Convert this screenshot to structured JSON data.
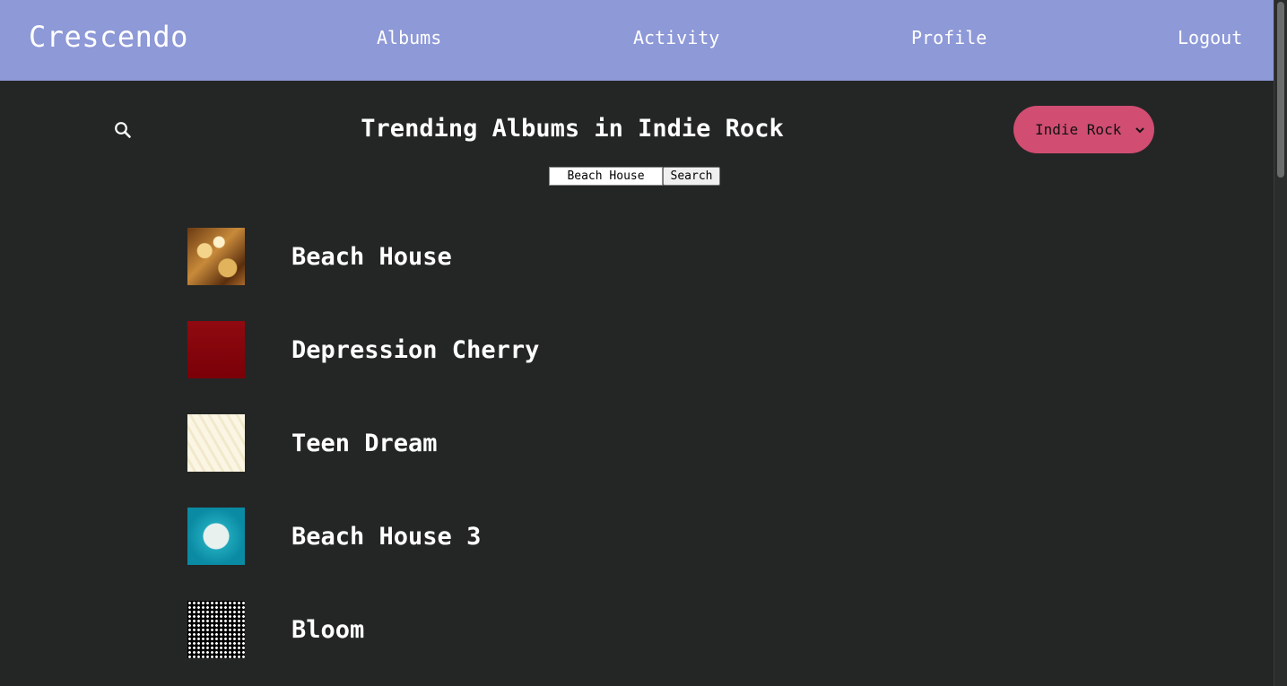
{
  "nav": {
    "brand": "Crescendo",
    "links": [
      "Albums",
      "Activity",
      "Profile",
      "Logout"
    ]
  },
  "main": {
    "title": "Trending Albums in Indie Rock",
    "genre_select": {
      "selected": "Indie Rock"
    },
    "search": {
      "value": "Beach House",
      "button_label": "Search"
    }
  },
  "icons": {
    "search": "search-icon",
    "select_chevron": "chevron-down-icon"
  },
  "colors": {
    "navbar": "#8e99d7",
    "background": "#242626",
    "genre_select": "#d14d72",
    "text": "#ffffff"
  },
  "albums": [
    {
      "name": "Beach House"
    },
    {
      "name": "Depression Cherry"
    },
    {
      "name": "Teen Dream"
    },
    {
      "name": "Beach House 3"
    },
    {
      "name": "Bloom"
    }
  ]
}
